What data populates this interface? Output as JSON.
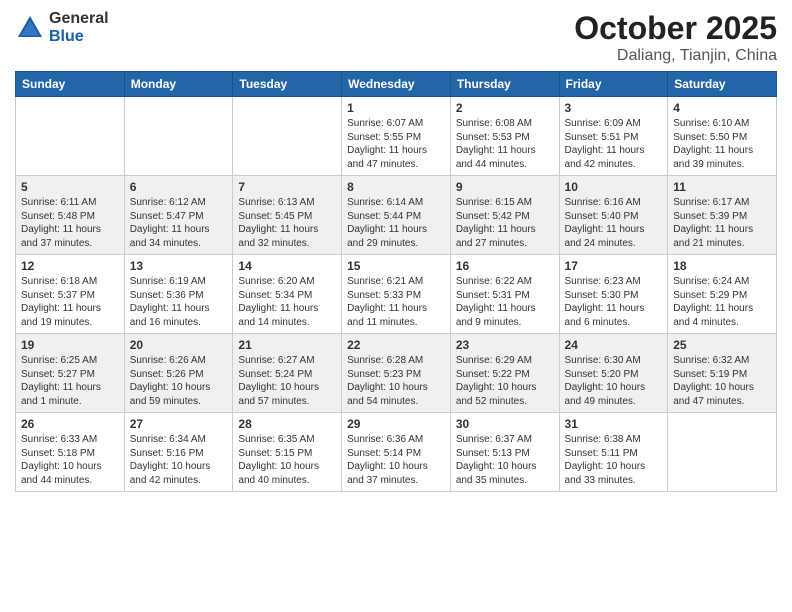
{
  "logo": {
    "general": "General",
    "blue": "Blue"
  },
  "title": "October 2025",
  "subtitle": "Daliang, Tianjin, China",
  "days_of_week": [
    "Sunday",
    "Monday",
    "Tuesday",
    "Wednesday",
    "Thursday",
    "Friday",
    "Saturday"
  ],
  "weeks": [
    [
      {
        "day": "",
        "info": ""
      },
      {
        "day": "",
        "info": ""
      },
      {
        "day": "",
        "info": ""
      },
      {
        "day": "1",
        "info": "Sunrise: 6:07 AM\nSunset: 5:55 PM\nDaylight: 11 hours and 47 minutes."
      },
      {
        "day": "2",
        "info": "Sunrise: 6:08 AM\nSunset: 5:53 PM\nDaylight: 11 hours and 44 minutes."
      },
      {
        "day": "3",
        "info": "Sunrise: 6:09 AM\nSunset: 5:51 PM\nDaylight: 11 hours and 42 minutes."
      },
      {
        "day": "4",
        "info": "Sunrise: 6:10 AM\nSunset: 5:50 PM\nDaylight: 11 hours and 39 minutes."
      }
    ],
    [
      {
        "day": "5",
        "info": "Sunrise: 6:11 AM\nSunset: 5:48 PM\nDaylight: 11 hours and 37 minutes."
      },
      {
        "day": "6",
        "info": "Sunrise: 6:12 AM\nSunset: 5:47 PM\nDaylight: 11 hours and 34 minutes."
      },
      {
        "day": "7",
        "info": "Sunrise: 6:13 AM\nSunset: 5:45 PM\nDaylight: 11 hours and 32 minutes."
      },
      {
        "day": "8",
        "info": "Sunrise: 6:14 AM\nSunset: 5:44 PM\nDaylight: 11 hours and 29 minutes."
      },
      {
        "day": "9",
        "info": "Sunrise: 6:15 AM\nSunset: 5:42 PM\nDaylight: 11 hours and 27 minutes."
      },
      {
        "day": "10",
        "info": "Sunrise: 6:16 AM\nSunset: 5:40 PM\nDaylight: 11 hours and 24 minutes."
      },
      {
        "day": "11",
        "info": "Sunrise: 6:17 AM\nSunset: 5:39 PM\nDaylight: 11 hours and 21 minutes."
      }
    ],
    [
      {
        "day": "12",
        "info": "Sunrise: 6:18 AM\nSunset: 5:37 PM\nDaylight: 11 hours and 19 minutes."
      },
      {
        "day": "13",
        "info": "Sunrise: 6:19 AM\nSunset: 5:36 PM\nDaylight: 11 hours and 16 minutes."
      },
      {
        "day": "14",
        "info": "Sunrise: 6:20 AM\nSunset: 5:34 PM\nDaylight: 11 hours and 14 minutes."
      },
      {
        "day": "15",
        "info": "Sunrise: 6:21 AM\nSunset: 5:33 PM\nDaylight: 11 hours and 11 minutes."
      },
      {
        "day": "16",
        "info": "Sunrise: 6:22 AM\nSunset: 5:31 PM\nDaylight: 11 hours and 9 minutes."
      },
      {
        "day": "17",
        "info": "Sunrise: 6:23 AM\nSunset: 5:30 PM\nDaylight: 11 hours and 6 minutes."
      },
      {
        "day": "18",
        "info": "Sunrise: 6:24 AM\nSunset: 5:29 PM\nDaylight: 11 hours and 4 minutes."
      }
    ],
    [
      {
        "day": "19",
        "info": "Sunrise: 6:25 AM\nSunset: 5:27 PM\nDaylight: 11 hours and 1 minute."
      },
      {
        "day": "20",
        "info": "Sunrise: 6:26 AM\nSunset: 5:26 PM\nDaylight: 10 hours and 59 minutes."
      },
      {
        "day": "21",
        "info": "Sunrise: 6:27 AM\nSunset: 5:24 PM\nDaylight: 10 hours and 57 minutes."
      },
      {
        "day": "22",
        "info": "Sunrise: 6:28 AM\nSunset: 5:23 PM\nDaylight: 10 hours and 54 minutes."
      },
      {
        "day": "23",
        "info": "Sunrise: 6:29 AM\nSunset: 5:22 PM\nDaylight: 10 hours and 52 minutes."
      },
      {
        "day": "24",
        "info": "Sunrise: 6:30 AM\nSunset: 5:20 PM\nDaylight: 10 hours and 49 minutes."
      },
      {
        "day": "25",
        "info": "Sunrise: 6:32 AM\nSunset: 5:19 PM\nDaylight: 10 hours and 47 minutes."
      }
    ],
    [
      {
        "day": "26",
        "info": "Sunrise: 6:33 AM\nSunset: 5:18 PM\nDaylight: 10 hours and 44 minutes."
      },
      {
        "day": "27",
        "info": "Sunrise: 6:34 AM\nSunset: 5:16 PM\nDaylight: 10 hours and 42 minutes."
      },
      {
        "day": "28",
        "info": "Sunrise: 6:35 AM\nSunset: 5:15 PM\nDaylight: 10 hours and 40 minutes."
      },
      {
        "day": "29",
        "info": "Sunrise: 6:36 AM\nSunset: 5:14 PM\nDaylight: 10 hours and 37 minutes."
      },
      {
        "day": "30",
        "info": "Sunrise: 6:37 AM\nSunset: 5:13 PM\nDaylight: 10 hours and 35 minutes."
      },
      {
        "day": "31",
        "info": "Sunrise: 6:38 AM\nSunset: 5:11 PM\nDaylight: 10 hours and 33 minutes."
      },
      {
        "day": "",
        "info": ""
      }
    ]
  ]
}
